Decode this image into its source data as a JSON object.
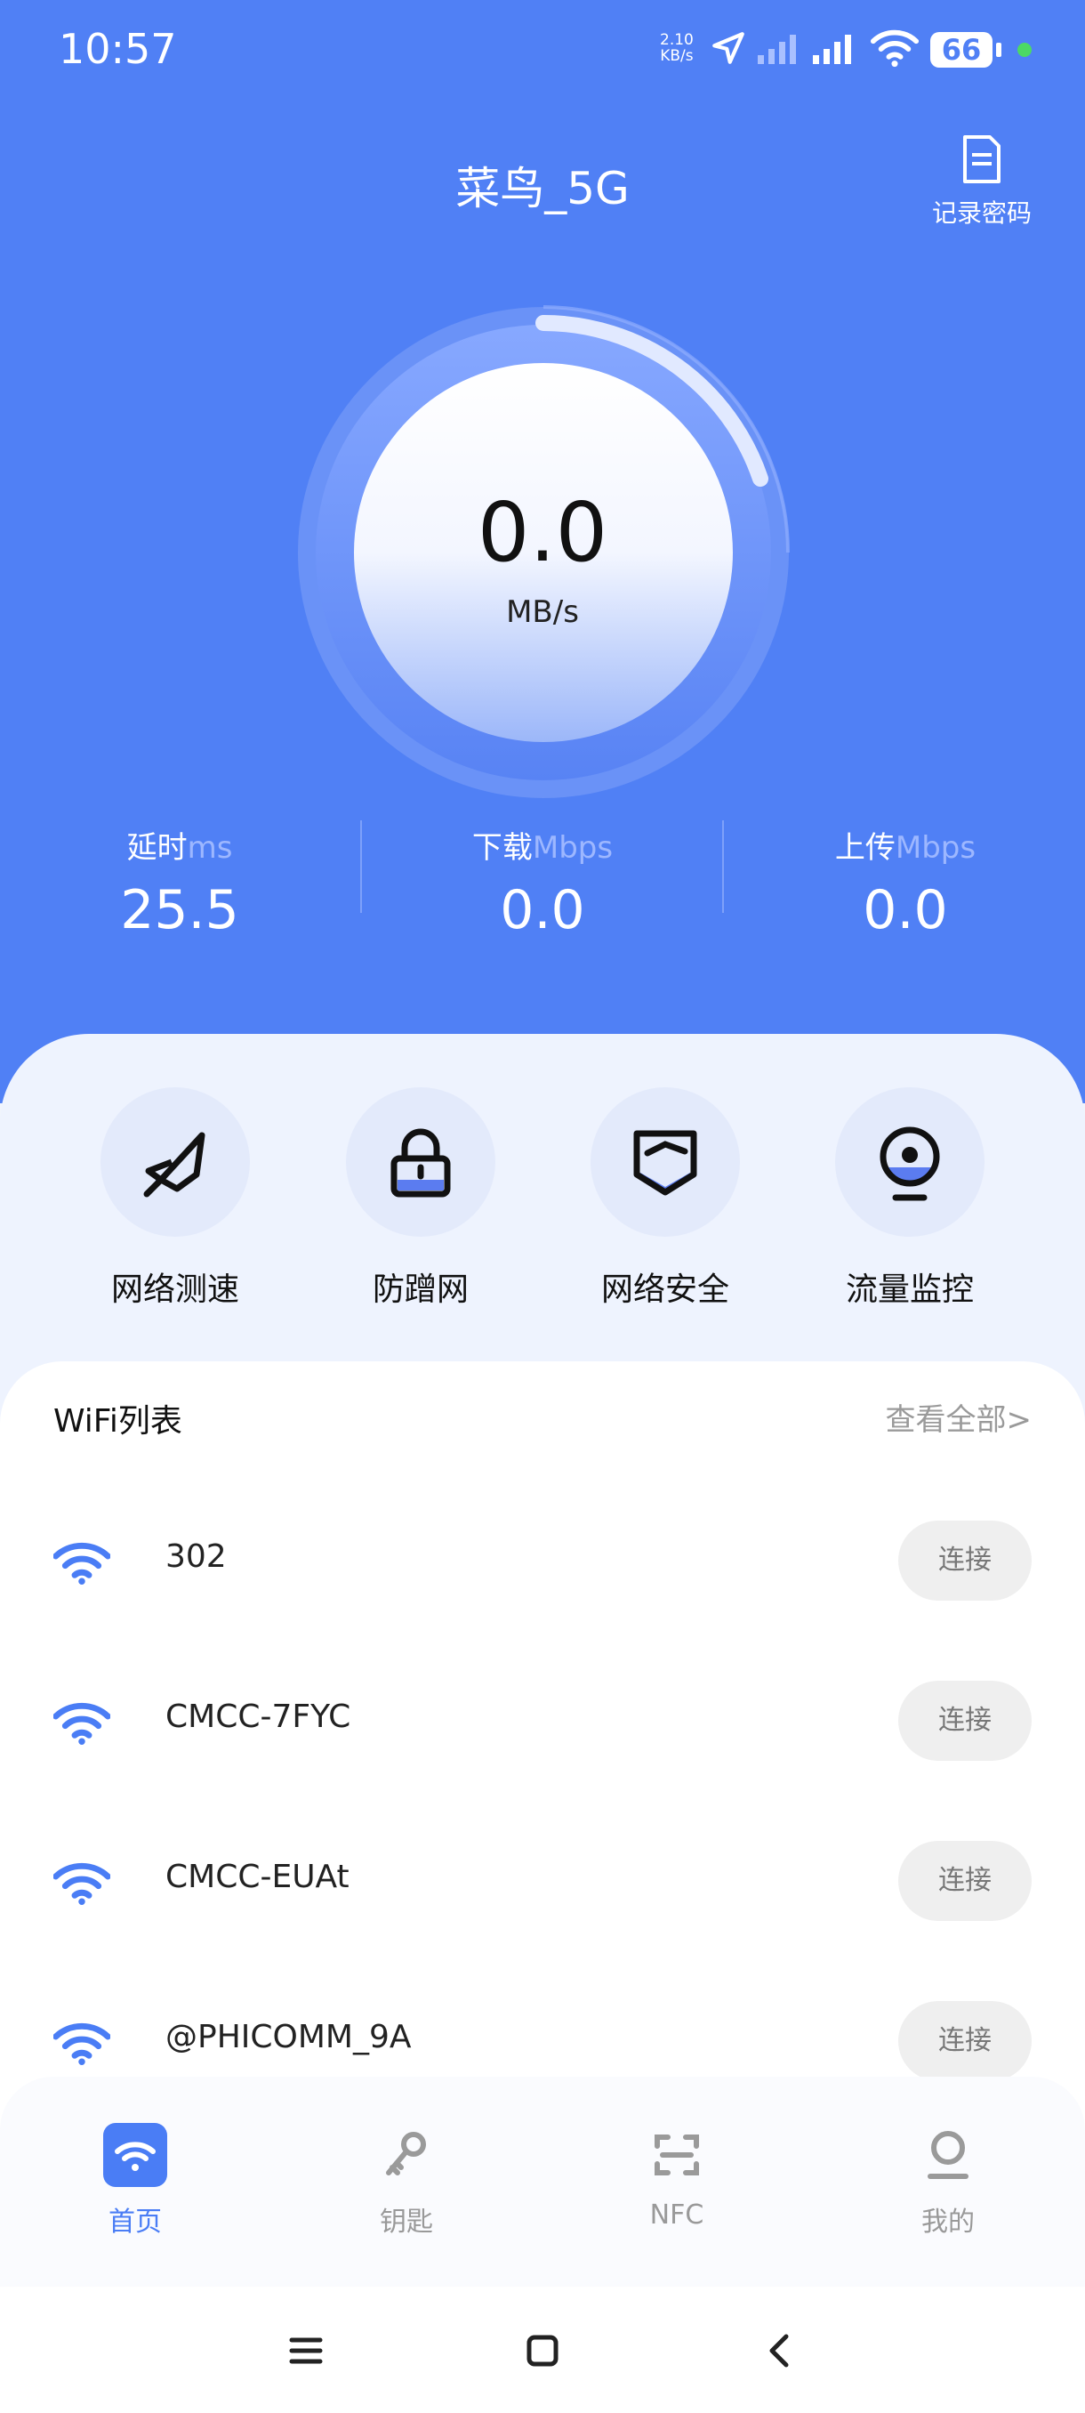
{
  "status": {
    "time": "10:57",
    "net_speed_value": "2.10",
    "net_speed_unit": "KB/s",
    "battery": "66"
  },
  "header": {
    "title": "菜鸟_5G",
    "record_label": "记录密码"
  },
  "gauge": {
    "value": "0.0",
    "unit": "MB/s"
  },
  "stats": [
    {
      "label": "延时",
      "unit": "ms",
      "value": "25.5"
    },
    {
      "label": "下载",
      "unit": "Mbps",
      "value": "0.0"
    },
    {
      "label": "上传",
      "unit": "Mbps",
      "value": "0.0"
    }
  ],
  "actions": [
    {
      "label": "网络测速",
      "icon": "rocket-icon"
    },
    {
      "label": "防蹭网",
      "icon": "lock-icon"
    },
    {
      "label": "网络安全",
      "icon": "shield-icon"
    },
    {
      "label": "流量监控",
      "icon": "webcam-icon"
    }
  ],
  "wifi": {
    "title": "WiFi列表",
    "view_all": "查看全部>",
    "connect_label": "连接",
    "networks": [
      "302",
      "CMCC-7FYC",
      "CMCC-EUAt",
      "@PHICOMM_9A"
    ]
  },
  "tabs": [
    {
      "label": "首页",
      "icon": "wifi-icon",
      "active": true
    },
    {
      "label": "钥匙",
      "icon": "key-icon",
      "active": false
    },
    {
      "label": "NFC",
      "icon": "nfc-scan-icon",
      "active": false
    },
    {
      "label": "我的",
      "icon": "profile-icon",
      "active": false
    }
  ],
  "colors": {
    "primary": "#5080f5",
    "accent": "#4a7df5"
  }
}
